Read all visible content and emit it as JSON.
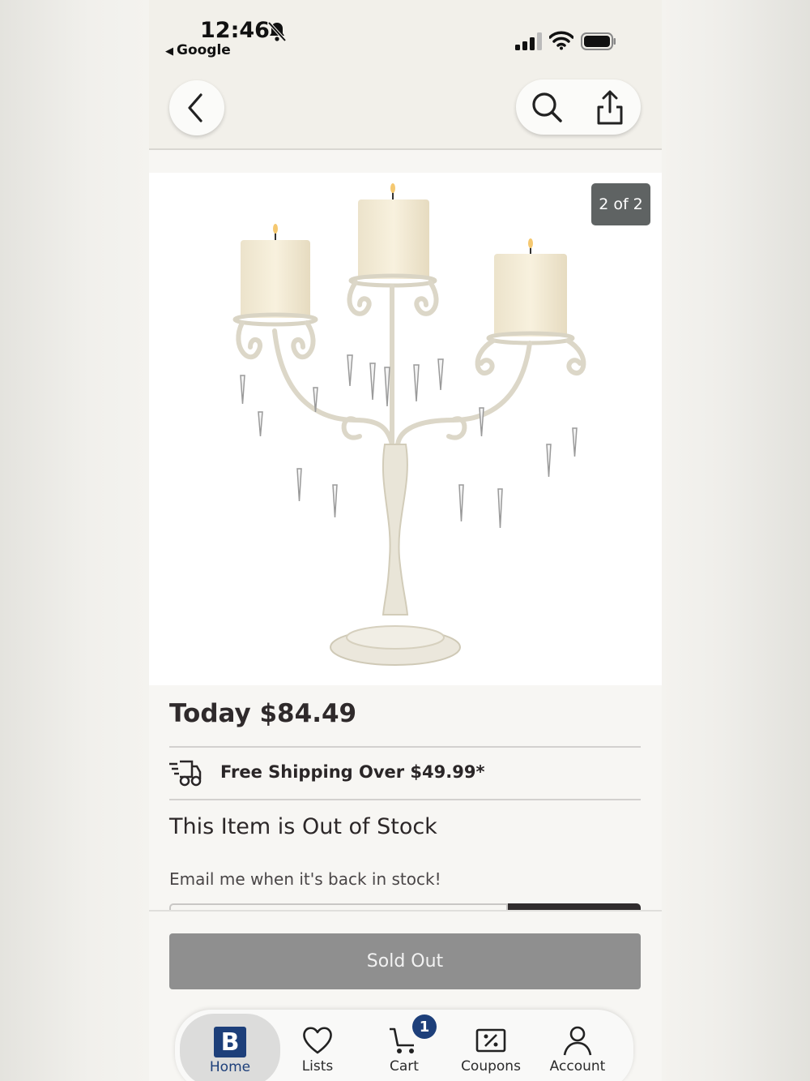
{
  "status_bar": {
    "time": "12:46",
    "back_app": "Google",
    "silent_icon": "bell-slash-icon",
    "signal_icon": "cellular-signal-icon",
    "wifi_icon": "wifi-icon",
    "battery_icon": "battery-icon"
  },
  "nav": {
    "back_icon": "chevron-left-icon",
    "search_icon": "search-icon",
    "share_icon": "share-icon"
  },
  "gallery": {
    "counter": "2 of 2"
  },
  "product": {
    "price": "Today $84.49",
    "shipping": "Free Shipping Over $49.99*",
    "stock_status": "This Item is Out of Stock",
    "email_prompt": "Email me when it's back in stock!",
    "sold_out_label": "Sold Out"
  },
  "tabbar": {
    "tabs": [
      {
        "label": "Home",
        "icon": "home-logo-icon"
      },
      {
        "label": "Lists",
        "icon": "heart-icon"
      },
      {
        "label": "Cart",
        "icon": "cart-icon",
        "badge": "1"
      },
      {
        "label": "Coupons",
        "icon": "coupon-icon"
      },
      {
        "label": "Account",
        "icon": "person-icon"
      }
    ],
    "home_logo_letter": "B"
  },
  "colors": {
    "brand_blue": "#1d3f7a",
    "sold_out_gray": "#8f8f8f",
    "counter_bg": "#5f6363"
  }
}
